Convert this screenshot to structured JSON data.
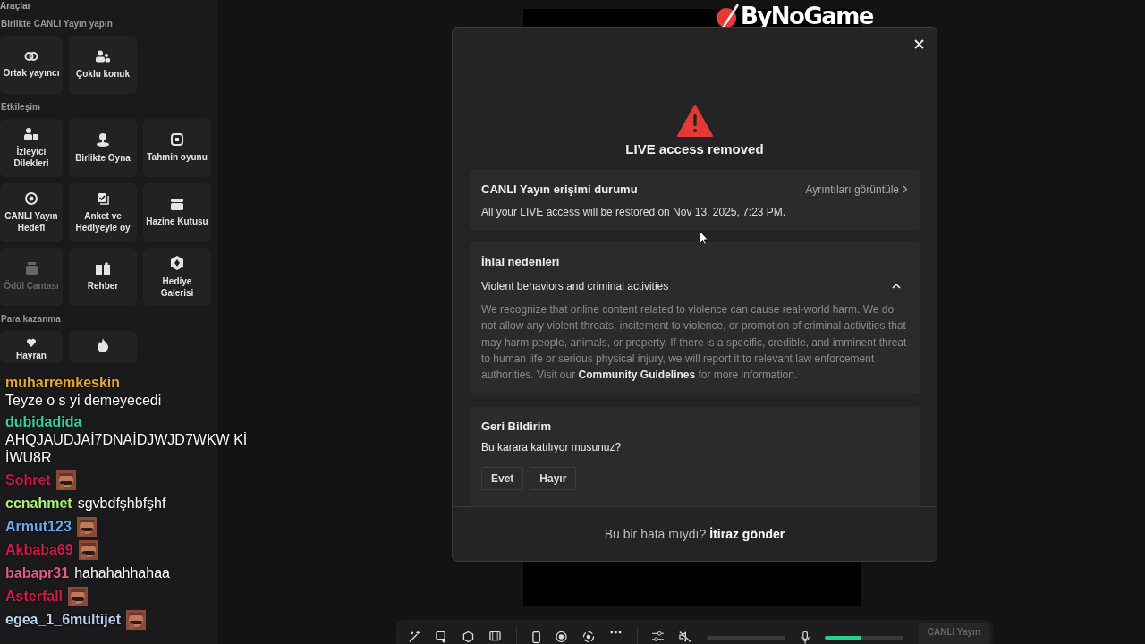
{
  "logo": {
    "text": "ByNoGame"
  },
  "sidebar": {
    "title": "Araçlar",
    "sections": [
      {
        "title": "Birlikte CANLI Yayın yapın",
        "tiles": [
          {
            "label": "Ortak yayıncı",
            "disabled": false
          },
          {
            "label": "Çoklu konuk",
            "disabled": false
          }
        ]
      },
      {
        "title": "Etkileşim",
        "tiles": [
          {
            "label": "İzleyici Dilekleri",
            "disabled": false
          },
          {
            "label": "Birlikte Oyna",
            "disabled": false
          },
          {
            "label": "Tahmin oyunu",
            "disabled": false
          },
          {
            "label": "CANLI Yayın Hedefi",
            "disabled": false
          },
          {
            "label": "Anket ve Hediyeyle oy",
            "disabled": false
          },
          {
            "label": "Hazine Kutusu",
            "disabled": false
          },
          {
            "label": "Ödül Çantası",
            "disabled": true
          },
          {
            "label": "Rehber",
            "disabled": false
          },
          {
            "label": "Hediye Galerisi",
            "disabled": false
          }
        ]
      },
      {
        "title": "Para kazanma",
        "tiles": [
          {
            "label": "Hayran",
            "disabled": false
          },
          {
            "disabled": false
          }
        ]
      }
    ]
  },
  "chat": [
    {
      "user": "muharremkeskin",
      "color": "#e8a33a",
      "text": "Teyze o s yi demeyecedi",
      "emote": false
    },
    {
      "user": "dubidadida",
      "color": "#3ccf9c",
      "text": "AHQJAUDJAİ7DNAİDJWJD7WKW Kİ İWU8R",
      "emote": false
    },
    {
      "user": "Sohret",
      "color": "#c8194a",
      "emote": true
    },
    {
      "user": "ccnahmet",
      "color": "#a8f07a",
      "text": "sgvbdfşhbfşhf",
      "emote": false
    },
    {
      "user": "Armut123",
      "color": "#6fa8e8",
      "emote": true
    },
    {
      "user": "Akbaba69",
      "color": "#d41a4a",
      "emote": true
    },
    {
      "user": "babapr31",
      "color": "#e05a8a",
      "text": "hahahahhahaa",
      "emote": false
    },
    {
      "user": "Asterfall",
      "color": "#d61a48",
      "emote": true
    },
    {
      "user": "egea_1_6multijet",
      "color": "#b8d0f0",
      "emote": true
    }
  ],
  "modal": {
    "title": "LIVE access removed",
    "status": {
      "title": "CANLI Yayın erişimi durumu",
      "link": "Ayrıntıları görüntüle",
      "text": "All your LIVE access will be restored on Nov 13, 2025, 7:23 PM."
    },
    "violations": {
      "title": "İhlal nedenleri",
      "reason": "Violent behaviors and criminal activities",
      "expanded": true,
      "text": "We recognize that online content related to violence can cause real-world harm. We do not allow any violent threats, incitement to violence, or promotion of criminal activities that may harm people, animals, or property. If there is a specific, credible, and imminent threat to human life or serious physical injury, we will report it to relevant law enforcement authorities. Visit our",
      "link": "Community Guidelines",
      "text_after": "for more information."
    },
    "feedback": {
      "title": "Geri Bildirim",
      "question": "Bu karara katılıyor musunuz?",
      "buttons": [
        "Evet",
        "Hayır"
      ]
    },
    "footer": {
      "text": "Bu bir hata mıydı?",
      "link": "İtiraz gönder"
    }
  },
  "toolbar": {
    "speaker_muted": true,
    "mic": {
      "level": 0.47
    },
    "go_live": {
      "label": "CANLI Yayın",
      "disabled": true
    }
  }
}
